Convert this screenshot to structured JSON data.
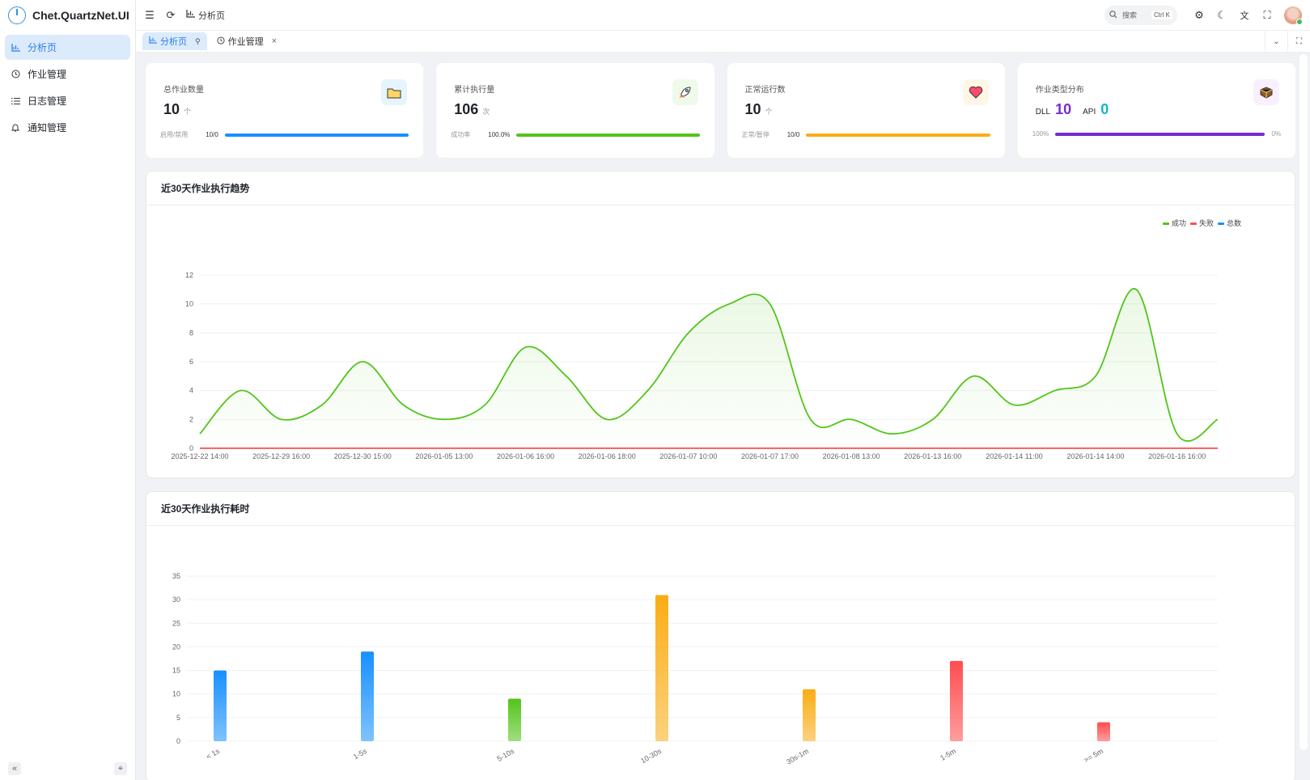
{
  "app": {
    "title": "Chet.QuartzNet.UI"
  },
  "sidebar": {
    "items": [
      {
        "label": "分析页",
        "icon": "chart-icon",
        "active": true
      },
      {
        "label": "作业管理",
        "icon": "clock-icon",
        "active": false
      },
      {
        "label": "日志管理",
        "icon": "list-icon",
        "active": false
      },
      {
        "label": "通知管理",
        "icon": "bell-icon",
        "active": false
      }
    ]
  },
  "header": {
    "breadcrumb": "分析页",
    "search_placeholder": "搜索",
    "search_shortcut": "Ctrl K"
  },
  "tabs": [
    {
      "label": "分析页",
      "active": true
    },
    {
      "label": "作业管理",
      "active": false
    }
  ],
  "stats": {
    "total": {
      "label": "总作业数量",
      "value": "10",
      "unit": "个",
      "foot_label": "启用/禁用",
      "foot_value": "10/0",
      "color": "#1890ff",
      "fill": 1.0
    },
    "exec": {
      "label": "累计执行量",
      "value": "106",
      "unit": "次",
      "foot_label": "成功率",
      "foot_value": "100.0%",
      "color": "#52c41a",
      "fill": 1.0
    },
    "running": {
      "label": "正常运行数",
      "value": "10",
      "unit": "个",
      "foot_label": "正常/暂停",
      "foot_value": "10/0",
      "color": "#faad14",
      "fill": 1.0
    },
    "types": {
      "label": "作业类型分布",
      "dll_label": "DLL",
      "dll_value": "10",
      "api_label": "API",
      "api_value": "0",
      "foot_left": "100%",
      "foot_right": "0%",
      "color": "#722ed1",
      "fill": 1.0
    }
  },
  "trend": {
    "title": "近30天作业执行趋势"
  },
  "duration": {
    "title": "近30天作业执行耗时"
  },
  "chart_data": [
    {
      "type": "line",
      "categories": [
        "2025-12-22 14:00",
        "2025-12-29 16:00",
        "2025-12-30 15:00",
        "2026-01-05 13:00",
        "2026-01-06 16:00",
        "2026-01-06 18:00",
        "2026-01-07 10:00",
        "2026-01-07 17:00",
        "2026-01-08 13:00",
        "2026-01-13 16:00",
        "2026-01-14 11:00",
        "2026-01-14 14:00",
        "2026-01-16 16:00"
      ],
      "x": [
        0,
        0.5,
        1,
        1.5,
        2,
        2.5,
        3,
        3.5,
        4,
        4.5,
        5,
        5.5,
        6,
        6.5,
        7,
        7.5,
        8,
        8.5,
        9,
        9.5,
        10,
        10.5,
        11,
        11.5,
        12,
        12.5
      ],
      "series": [
        {
          "name": "成功",
          "color": "#52c41a",
          "values": [
            1,
            4,
            2,
            3,
            6,
            3,
            2,
            3,
            7,
            5,
            2,
            4,
            8,
            10,
            10,
            2,
            2,
            1,
            2,
            5,
            3,
            4,
            5,
            11,
            1,
            2
          ]
        },
        {
          "name": "失败",
          "color": "#ff4d4f",
          "values": [
            0,
            0,
            0,
            0,
            0,
            0,
            0,
            0,
            0,
            0,
            0,
            0,
            0,
            0,
            0,
            0,
            0,
            0,
            0,
            0,
            0,
            0,
            0,
            0,
            0,
            0
          ]
        },
        {
          "name": "总数",
          "color": "#1890ff",
          "values": []
        }
      ],
      "ylim": [
        0,
        12
      ],
      "yticks": [
        0,
        2,
        4,
        6,
        8,
        10,
        12
      ],
      "legend": "top-right"
    },
    {
      "type": "bar",
      "categories": [
        "< 1s",
        "1-5s",
        "5-10s",
        "10-30s",
        "30s-1m",
        "1-5m",
        ">= 5m"
      ],
      "values": [
        15,
        19,
        9,
        31,
        11,
        17,
        4
      ],
      "colors": [
        "#1890ff",
        "#1890ff",
        "#52c41a",
        "#faad14",
        "#faad14",
        "#ff4d4f",
        "#ff4d4f"
      ],
      "ylim": [
        0,
        35
      ],
      "yticks": [
        0,
        5,
        10,
        15,
        20,
        25,
        30,
        35
      ]
    }
  ]
}
